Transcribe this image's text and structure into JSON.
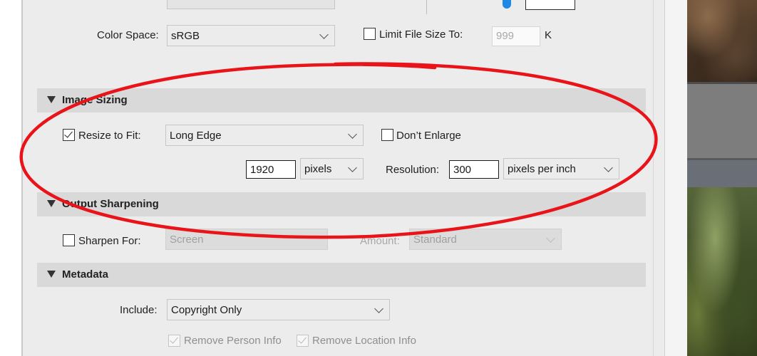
{
  "file_settings": {
    "color_space_label": "Color Space:",
    "color_space_value": "sRGB",
    "limit_file_size_label": "Limit File Size To:",
    "limit_file_size_checked": false,
    "limit_file_size_value": "999",
    "limit_file_size_unit": "K"
  },
  "image_sizing": {
    "title": "Image Sizing",
    "resize_to_fit_label": "Resize to Fit:",
    "resize_to_fit_checked": true,
    "resize_mode": "Long Edge",
    "dont_enlarge_label": "Don’t Enlarge",
    "dont_enlarge_checked": false,
    "size_value": "1920",
    "size_unit": "pixels",
    "resolution_label": "Resolution:",
    "resolution_value": "300",
    "resolution_unit": "pixels per inch"
  },
  "output_sharpening": {
    "title": "Output Sharpening",
    "sharpen_for_label": "Sharpen For:",
    "sharpen_for_checked": false,
    "sharpen_for_value": "Screen",
    "amount_label": "Amount:",
    "amount_value": "Standard"
  },
  "metadata": {
    "title": "Metadata",
    "include_label": "Include:",
    "include_value": "Copyright Only",
    "remove_person_info_label": "Remove Person Info",
    "remove_person_info_checked": true,
    "remove_location_info_label": "Remove Location Info",
    "remove_location_info_checked": true
  },
  "annotation": {
    "color": "#e8141a"
  },
  "colors": {
    "panel_bg": "#ececec",
    "section_header_bg": "#d9d9d9"
  }
}
